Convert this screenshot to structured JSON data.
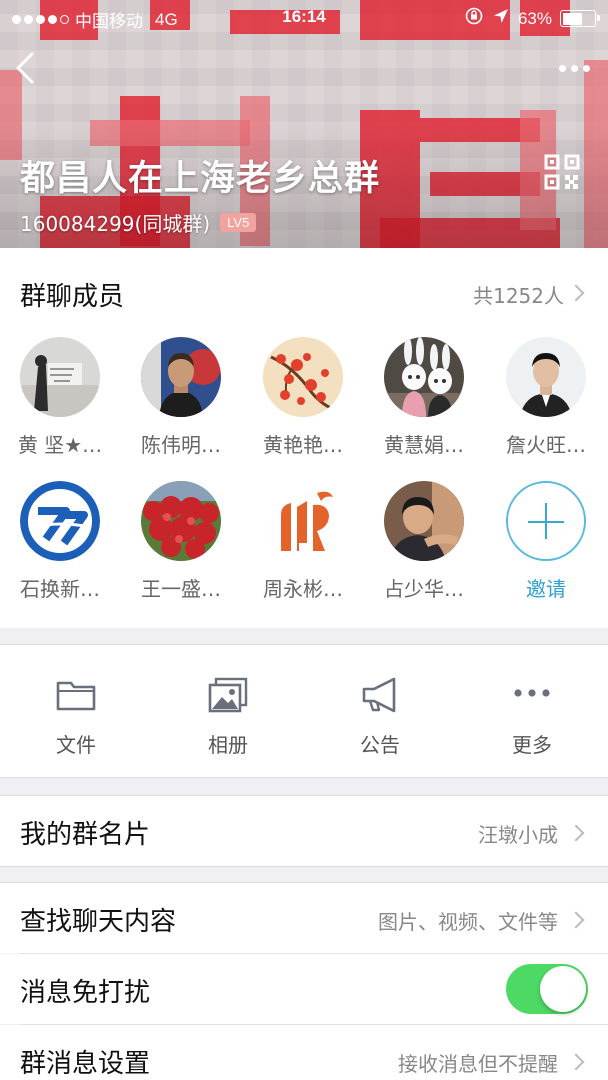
{
  "status_bar": {
    "carrier": "中国移动",
    "network": "4G",
    "time": "16:14",
    "battery": "63%",
    "battery_level": 0.63,
    "signal_bars_filled": 4,
    "signal_bars_total": 5
  },
  "header": {
    "title": "都昌人在上海老乡总群",
    "group_id": "160084299(同城群)",
    "level": "LV5"
  },
  "members": {
    "title": "群聊成员",
    "count": "共1252人",
    "list": [
      {
        "name": "黄 坚★…"
      },
      {
        "name": "陈伟明…"
      },
      {
        "name": "黄艳艳…"
      },
      {
        "name": "黄慧娟…"
      },
      {
        "name": "詹火旺…"
      },
      {
        "name": "石换新…"
      },
      {
        "name": "王一盛…"
      },
      {
        "name": "周永彬…"
      },
      {
        "name": "占少华…"
      }
    ],
    "invite_label": "邀请"
  },
  "tools": [
    {
      "label": "文件",
      "icon": "folder-icon"
    },
    {
      "label": "相册",
      "icon": "album-icon"
    },
    {
      "label": "公告",
      "icon": "megaphone-icon"
    },
    {
      "label": "更多",
      "icon": "more-dots-icon"
    }
  ],
  "settings": {
    "my_card": {
      "label": "我的群名片",
      "value": "汪墩小成"
    },
    "search_chat": {
      "label": "查找聊天内容",
      "value": "图片、视频、文件等"
    },
    "do_not_disturb": {
      "label": "消息免打扰",
      "on": true
    },
    "message_settings": {
      "label": "群消息设置",
      "value": "接收消息但不提醒"
    }
  },
  "colors": {
    "accent_blue": "#2f9fd6",
    "toggle_green": "#4cd964",
    "banner_red": "#e0212f"
  }
}
